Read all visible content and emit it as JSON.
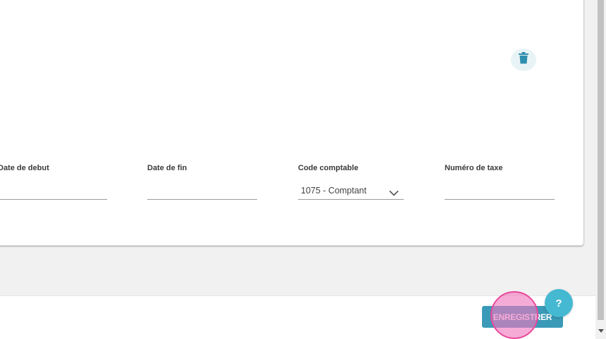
{
  "form": {
    "date_debut": {
      "label": "Date de debut",
      "value": ""
    },
    "date_fin": {
      "label": "Date de fin",
      "value": ""
    },
    "code_comptable": {
      "label": "Code comptable",
      "value": "1075 - Comptant"
    },
    "numero_taxe": {
      "label": "Numéro de taxe",
      "value": ""
    }
  },
  "footer": {
    "save_label": "ENREGISTRER",
    "help_label": "?"
  },
  "icons": {
    "delete": "trash-icon",
    "dropdown": "chevron-down-icon",
    "scroll_down": "scroll-down-arrow-icon"
  },
  "colors": {
    "accent": "#3a9ab7",
    "help": "#45b8d2",
    "click_highlight": "#e8479a"
  }
}
